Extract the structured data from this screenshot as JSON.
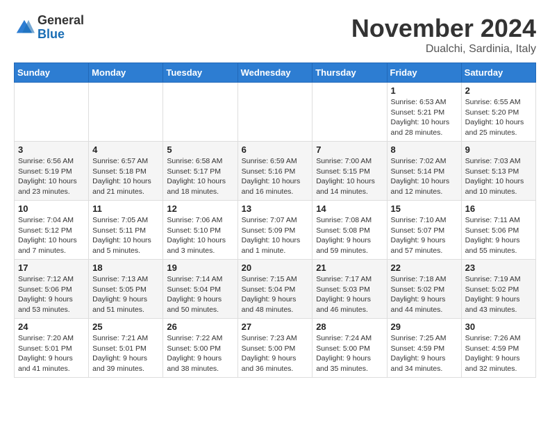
{
  "logo": {
    "general": "General",
    "blue": "Blue"
  },
  "title": "November 2024",
  "location": "Dualchi, Sardinia, Italy",
  "headers": [
    "Sunday",
    "Monday",
    "Tuesday",
    "Wednesday",
    "Thursday",
    "Friday",
    "Saturday"
  ],
  "weeks": [
    [
      {
        "day": "",
        "detail": ""
      },
      {
        "day": "",
        "detail": ""
      },
      {
        "day": "",
        "detail": ""
      },
      {
        "day": "",
        "detail": ""
      },
      {
        "day": "",
        "detail": ""
      },
      {
        "day": "1",
        "detail": "Sunrise: 6:53 AM\nSunset: 5:21 PM\nDaylight: 10 hours and 28 minutes."
      },
      {
        "day": "2",
        "detail": "Sunrise: 6:55 AM\nSunset: 5:20 PM\nDaylight: 10 hours and 25 minutes."
      }
    ],
    [
      {
        "day": "3",
        "detail": "Sunrise: 6:56 AM\nSunset: 5:19 PM\nDaylight: 10 hours and 23 minutes."
      },
      {
        "day": "4",
        "detail": "Sunrise: 6:57 AM\nSunset: 5:18 PM\nDaylight: 10 hours and 21 minutes."
      },
      {
        "day": "5",
        "detail": "Sunrise: 6:58 AM\nSunset: 5:17 PM\nDaylight: 10 hours and 18 minutes."
      },
      {
        "day": "6",
        "detail": "Sunrise: 6:59 AM\nSunset: 5:16 PM\nDaylight: 10 hours and 16 minutes."
      },
      {
        "day": "7",
        "detail": "Sunrise: 7:00 AM\nSunset: 5:15 PM\nDaylight: 10 hours and 14 minutes."
      },
      {
        "day": "8",
        "detail": "Sunrise: 7:02 AM\nSunset: 5:14 PM\nDaylight: 10 hours and 12 minutes."
      },
      {
        "day": "9",
        "detail": "Sunrise: 7:03 AM\nSunset: 5:13 PM\nDaylight: 10 hours and 10 minutes."
      }
    ],
    [
      {
        "day": "10",
        "detail": "Sunrise: 7:04 AM\nSunset: 5:12 PM\nDaylight: 10 hours and 7 minutes."
      },
      {
        "day": "11",
        "detail": "Sunrise: 7:05 AM\nSunset: 5:11 PM\nDaylight: 10 hours and 5 minutes."
      },
      {
        "day": "12",
        "detail": "Sunrise: 7:06 AM\nSunset: 5:10 PM\nDaylight: 10 hours and 3 minutes."
      },
      {
        "day": "13",
        "detail": "Sunrise: 7:07 AM\nSunset: 5:09 PM\nDaylight: 10 hours and 1 minute."
      },
      {
        "day": "14",
        "detail": "Sunrise: 7:08 AM\nSunset: 5:08 PM\nDaylight: 9 hours and 59 minutes."
      },
      {
        "day": "15",
        "detail": "Sunrise: 7:10 AM\nSunset: 5:07 PM\nDaylight: 9 hours and 57 minutes."
      },
      {
        "day": "16",
        "detail": "Sunrise: 7:11 AM\nSunset: 5:06 PM\nDaylight: 9 hours and 55 minutes."
      }
    ],
    [
      {
        "day": "17",
        "detail": "Sunrise: 7:12 AM\nSunset: 5:06 PM\nDaylight: 9 hours and 53 minutes."
      },
      {
        "day": "18",
        "detail": "Sunrise: 7:13 AM\nSunset: 5:05 PM\nDaylight: 9 hours and 51 minutes."
      },
      {
        "day": "19",
        "detail": "Sunrise: 7:14 AM\nSunset: 5:04 PM\nDaylight: 9 hours and 50 minutes."
      },
      {
        "day": "20",
        "detail": "Sunrise: 7:15 AM\nSunset: 5:04 PM\nDaylight: 9 hours and 48 minutes."
      },
      {
        "day": "21",
        "detail": "Sunrise: 7:17 AM\nSunset: 5:03 PM\nDaylight: 9 hours and 46 minutes."
      },
      {
        "day": "22",
        "detail": "Sunrise: 7:18 AM\nSunset: 5:02 PM\nDaylight: 9 hours and 44 minutes."
      },
      {
        "day": "23",
        "detail": "Sunrise: 7:19 AM\nSunset: 5:02 PM\nDaylight: 9 hours and 43 minutes."
      }
    ],
    [
      {
        "day": "24",
        "detail": "Sunrise: 7:20 AM\nSunset: 5:01 PM\nDaylight: 9 hours and 41 minutes."
      },
      {
        "day": "25",
        "detail": "Sunrise: 7:21 AM\nSunset: 5:01 PM\nDaylight: 9 hours and 39 minutes."
      },
      {
        "day": "26",
        "detail": "Sunrise: 7:22 AM\nSunset: 5:00 PM\nDaylight: 9 hours and 38 minutes."
      },
      {
        "day": "27",
        "detail": "Sunrise: 7:23 AM\nSunset: 5:00 PM\nDaylight: 9 hours and 36 minutes."
      },
      {
        "day": "28",
        "detail": "Sunrise: 7:24 AM\nSunset: 5:00 PM\nDaylight: 9 hours and 35 minutes."
      },
      {
        "day": "29",
        "detail": "Sunrise: 7:25 AM\nSunset: 4:59 PM\nDaylight: 9 hours and 34 minutes."
      },
      {
        "day": "30",
        "detail": "Sunrise: 7:26 AM\nSunset: 4:59 PM\nDaylight: 9 hours and 32 minutes."
      }
    ]
  ]
}
